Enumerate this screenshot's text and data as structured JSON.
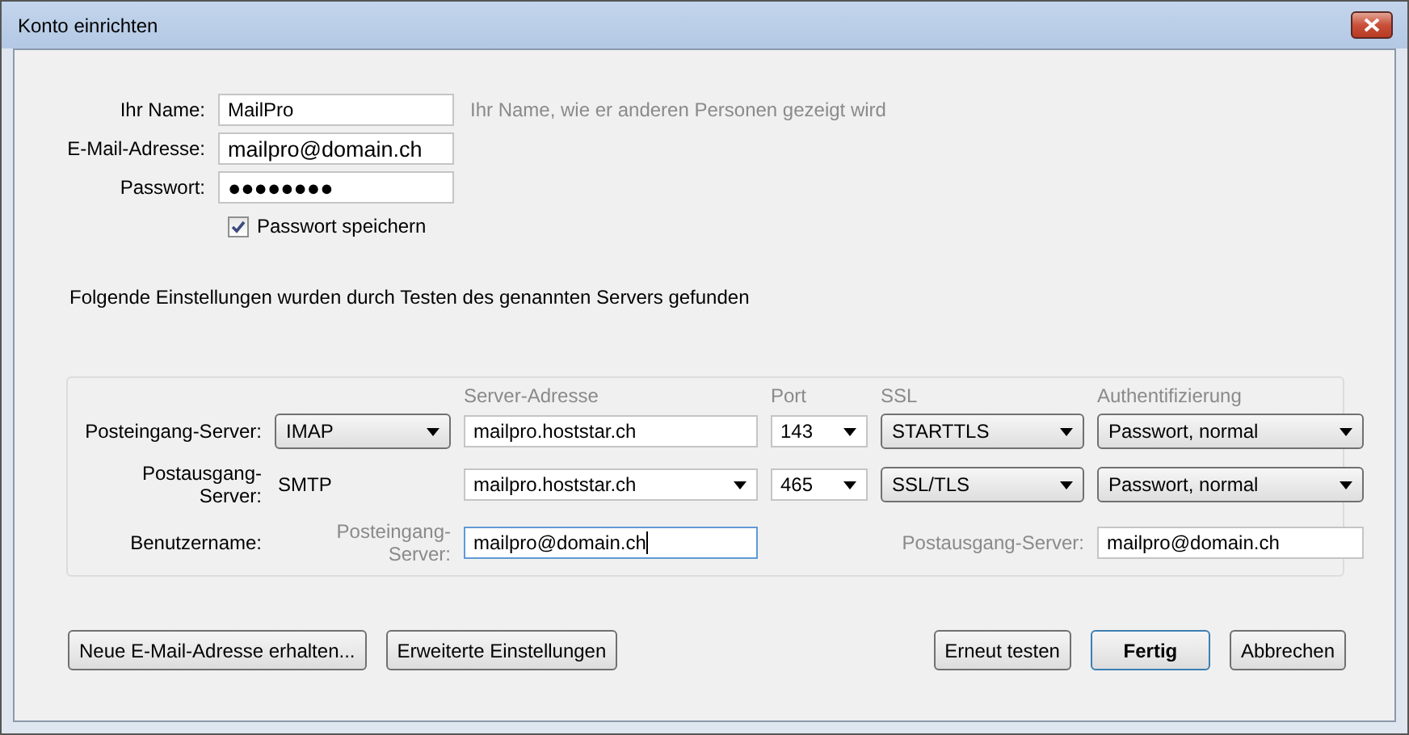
{
  "window": {
    "title": "Konto einrichten"
  },
  "identity": {
    "fields": [
      {
        "label": "Ihr Name:",
        "value": "MailPro",
        "hint": "Ihr Name, wie er anderen Personen gezeigt wird"
      },
      {
        "label": "E-Mail-Adresse:",
        "value": "mailpro@domain.ch"
      },
      {
        "label": "Passwort:",
        "value": "●●●●●●●●"
      }
    ],
    "remember": {
      "label": "Passwort speichern",
      "checked": true
    }
  },
  "message": "Folgende Einstellungen wurden durch Testen des genannten Servers gefunden",
  "servers": {
    "columns": [
      "Server-Adresse",
      "Port",
      "SSL",
      "Authentifizierung"
    ],
    "rows": [
      {
        "label": "Posteingang-Server:",
        "type": {
          "value": "IMAP",
          "kind": "dropdown"
        },
        "address": {
          "value": "mailpro.hoststar.ch",
          "kind": "text"
        },
        "port": "143",
        "ssl": "STARTTLS",
        "auth": "Passwort, normal"
      },
      {
        "label": "Postausgang-Server:",
        "type": {
          "value": "SMTP",
          "kind": "static"
        },
        "address": {
          "value": "mailpro.hoststar.ch",
          "kind": "combo"
        },
        "port": "465",
        "ssl": "SSL/TLS",
        "auth": "Passwort, normal"
      }
    ],
    "username": {
      "label": "Benutzername:",
      "incoming_label": "Posteingang-Server:",
      "incoming": {
        "value": "mailpro@domain.ch",
        "focused": true
      },
      "outgoing_label": "Postausgang-Server:",
      "outgoing": {
        "value": "mailpro@domain.ch",
        "focused": false
      }
    }
  },
  "buttons_left": [
    "Neue E-Mail-Adresse erhalten...",
    "Erweiterte Einstellungen"
  ],
  "buttons_right": [
    {
      "label": "Erneut testen",
      "default": false
    },
    {
      "label": "Fertig",
      "default": true
    },
    {
      "label": "Abbrechen",
      "default": false
    }
  ]
}
